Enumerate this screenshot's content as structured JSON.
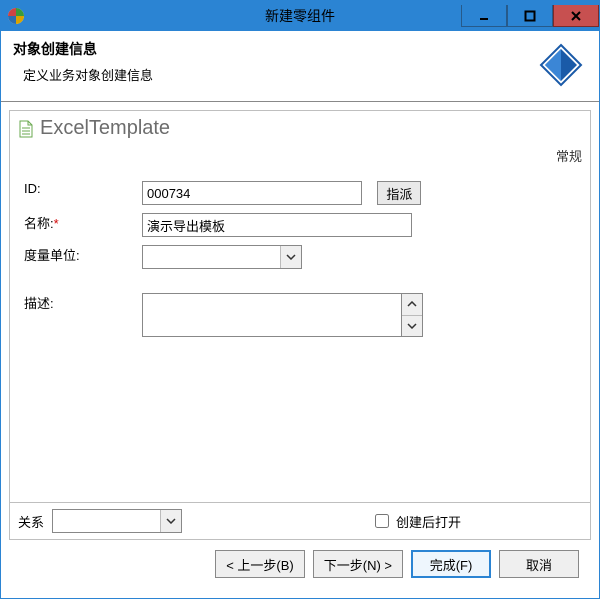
{
  "window": {
    "title": "新建零组件"
  },
  "banner": {
    "heading": "对象创建信息",
    "subtext": "定义业务对象创建信息"
  },
  "panel": {
    "type_label": "ExcelTemplate",
    "tab": "常规"
  },
  "form": {
    "id_label": "ID:",
    "id_value": "000734",
    "assign_btn": "指派",
    "name_label": "名称:",
    "name_value": "演示导出模板",
    "uom_label": "度量单位:",
    "uom_value": "",
    "desc_label": "描述:",
    "desc_value": ""
  },
  "panel_footer": {
    "relation_label": "关系",
    "relation_value": "",
    "open_after_label": "创建后打开"
  },
  "buttons": {
    "back": "< 上一步(B)",
    "next": "下一步(N) >",
    "finish": "完成(F)",
    "cancel": "取消"
  }
}
